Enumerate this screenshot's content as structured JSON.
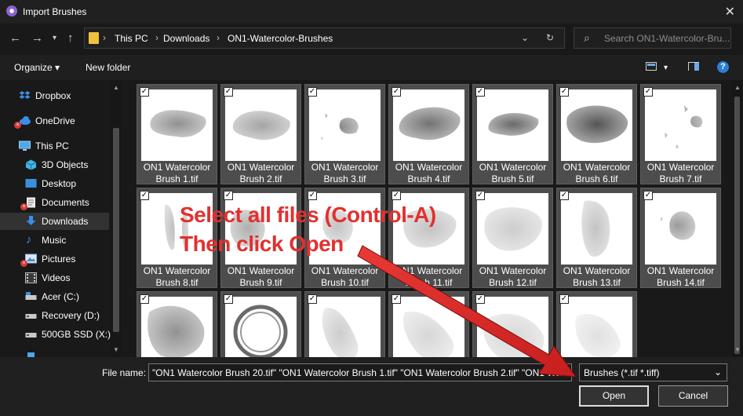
{
  "window": {
    "title": "Import Brushes",
    "close_icon": "close-icon"
  },
  "address_bar": {
    "breadcrumbs": [
      "This PC",
      "Downloads",
      "ON1-Watercolor-Brushes"
    ]
  },
  "search": {
    "placeholder": "Search ON1-Watercolor-Bru..."
  },
  "toolbar": {
    "organize_label": "Organize ▾",
    "new_folder_label": "New folder"
  },
  "sidebar": {
    "items": [
      {
        "label": "Dropbox",
        "icon": "dropbox-icon"
      },
      {
        "label": "OneDrive",
        "icon": "cloud-icon"
      },
      {
        "label": "This PC",
        "icon": "computer-icon"
      },
      {
        "label": "3D Objects",
        "icon": "cube-icon"
      },
      {
        "label": "Desktop",
        "icon": "desktop-icon"
      },
      {
        "label": "Documents",
        "icon": "document-icon"
      },
      {
        "label": "Downloads",
        "icon": "download-icon"
      },
      {
        "label": "Music",
        "icon": "music-icon"
      },
      {
        "label": "Pictures",
        "icon": "picture-icon"
      },
      {
        "label": "Videos",
        "icon": "video-icon"
      },
      {
        "label": "Acer (C:)",
        "icon": "drive-icon"
      },
      {
        "label": "Recovery (D:)",
        "icon": "drive-icon"
      },
      {
        "label": "500GB SSD (X:)",
        "icon": "drive-icon"
      }
    ]
  },
  "files": [
    {
      "line1": "ON1 Watercolor",
      "line2": "Brush 1.tif"
    },
    {
      "line1": "ON1 Watercolor",
      "line2": "Brush 2.tif"
    },
    {
      "line1": "ON1 Watercolor",
      "line2": "Brush 3.tif"
    },
    {
      "line1": "ON1 Watercolor",
      "line2": "Brush 4.tif"
    },
    {
      "line1": "ON1 Watercolor",
      "line2": "Brush 5.tif"
    },
    {
      "line1": "ON1 Watercolor",
      "line2": "Brush 6.tif"
    },
    {
      "line1": "ON1 Watercolor",
      "line2": "Brush 7.tif"
    },
    {
      "line1": "ON1 Watercolor",
      "line2": "Brush 8.tif"
    },
    {
      "line1": "ON1 Watercolor",
      "line2": "Brush 9.tif"
    },
    {
      "line1": "ON1 Watercolor",
      "line2": "Brush 10.tif"
    },
    {
      "line1": "ON1 Watercolor",
      "line2": "Brush 11.tif"
    },
    {
      "line1": "ON1 Watercolor",
      "line2": "Brush 12.tif"
    },
    {
      "line1": "ON1 Watercolor",
      "line2": "Brush 13.tif"
    },
    {
      "line1": "ON1 Watercolor",
      "line2": "Brush 14.tif"
    },
    {
      "line1": "",
      "line2": ""
    },
    {
      "line1": "",
      "line2": ""
    },
    {
      "line1": "",
      "line2": ""
    },
    {
      "line1": "",
      "line2": ""
    },
    {
      "line1": "",
      "line2": ""
    },
    {
      "line1": "",
      "line2": ""
    }
  ],
  "bottom": {
    "file_name_label": "File name:",
    "file_name_value": "\"ON1 Watercolor Brush 20.tif\" \"ON1 Watercolor Brush 1.tif\" \"ON1 Watercolor Brush 2.tif\" \"ON1 Wa",
    "filter_value": "Brushes (*.tif *.tiff)",
    "open_label": "Open",
    "cancel_label": "Cancel"
  },
  "annotation": {
    "line1": "Select all files (Control-A)",
    "line2": "Then click Open",
    "color": "#e3302f"
  }
}
